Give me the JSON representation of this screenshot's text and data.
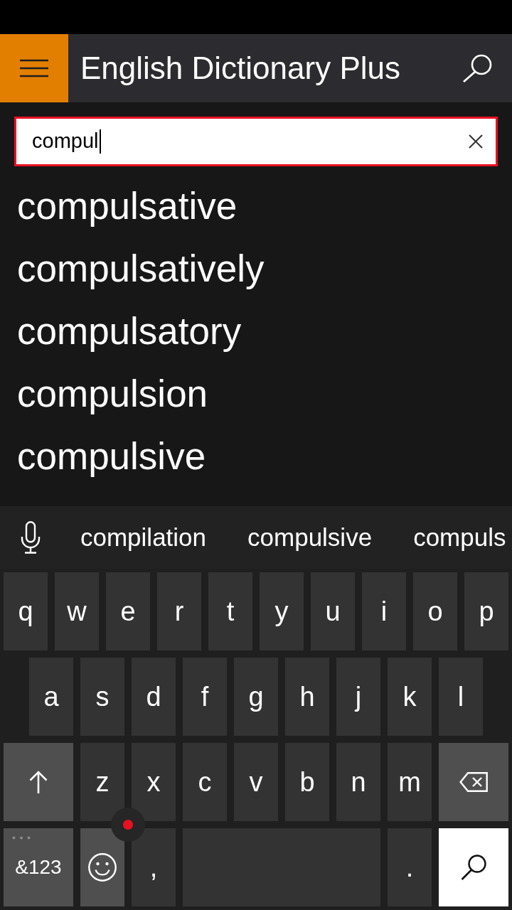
{
  "app_bar": {
    "title": "English Dictionary Plus"
  },
  "search": {
    "value": "compul",
    "focused": true
  },
  "results": [
    "compulsative",
    "compulsatively",
    "compulsatory",
    "compulsion",
    "compulsive"
  ],
  "keyboard": {
    "suggestions": [
      "compilation",
      "compulsive",
      "compuls"
    ],
    "rows": [
      {
        "keys": [
          {
            "kind": "letter",
            "label": "q"
          },
          {
            "kind": "letter",
            "label": "w"
          },
          {
            "kind": "letter",
            "label": "e"
          },
          {
            "kind": "letter",
            "label": "r"
          },
          {
            "kind": "letter",
            "label": "t"
          },
          {
            "kind": "letter",
            "label": "y"
          },
          {
            "kind": "letter",
            "label": "u"
          },
          {
            "kind": "letter",
            "label": "i"
          },
          {
            "kind": "letter",
            "label": "o"
          },
          {
            "kind": "letter",
            "label": "p"
          }
        ]
      },
      {
        "keys": [
          {
            "kind": "letter",
            "label": "a"
          },
          {
            "kind": "letter",
            "label": "s"
          },
          {
            "kind": "letter",
            "label": "d"
          },
          {
            "kind": "letter",
            "label": "f"
          },
          {
            "kind": "letter",
            "label": "g"
          },
          {
            "kind": "letter",
            "label": "h"
          },
          {
            "kind": "letter",
            "label": "j"
          },
          {
            "kind": "letter",
            "label": "k"
          },
          {
            "kind": "letter",
            "label": "l"
          }
        ]
      },
      {
        "keys": [
          {
            "kind": "shift"
          },
          {
            "kind": "letter",
            "label": "z"
          },
          {
            "kind": "letter",
            "label": "x"
          },
          {
            "kind": "letter",
            "label": "c"
          },
          {
            "kind": "letter",
            "label": "v"
          },
          {
            "kind": "letter",
            "label": "b"
          },
          {
            "kind": "letter",
            "label": "n"
          },
          {
            "kind": "letter",
            "label": "m"
          },
          {
            "kind": "backspace"
          }
        ]
      },
      {
        "keys": [
          {
            "kind": "symbols",
            "label": "&123"
          },
          {
            "kind": "emoji"
          },
          {
            "kind": "letter",
            "label": ","
          },
          {
            "kind": "space"
          },
          {
            "kind": "letter",
            "label": "."
          },
          {
            "kind": "search"
          }
        ]
      }
    ]
  }
}
